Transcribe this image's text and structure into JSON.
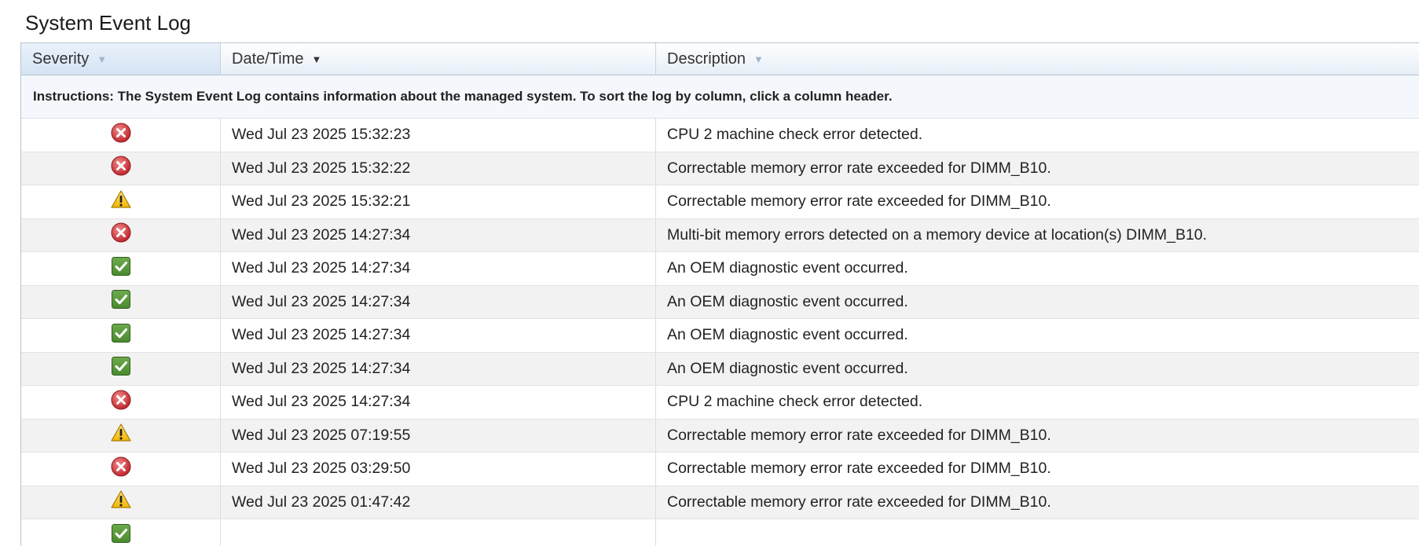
{
  "page": {
    "title": "System Event Log"
  },
  "table": {
    "columns": {
      "severity": "Severity",
      "datetime": "Date/Time",
      "description": "Description"
    },
    "sorted_column": "datetime",
    "instructions": "Instructions: The System Event Log contains information about the managed system. To sort the log by column, click a column header.",
    "rows": [
      {
        "severity": "error-icon",
        "datetime": "Wed Jul 23 2025 15:32:23",
        "description": "CPU 2 machine check error detected."
      },
      {
        "severity": "error-icon",
        "datetime": "Wed Jul 23 2025 15:32:22",
        "description": "Correctable memory error rate exceeded for DIMM_B10."
      },
      {
        "severity": "warning-icon",
        "datetime": "Wed Jul 23 2025 15:32:21",
        "description": "Correctable memory error rate exceeded for DIMM_B10."
      },
      {
        "severity": "error-icon",
        "datetime": "Wed Jul 23 2025 14:27:34",
        "description": "Multi-bit memory errors detected on a memory device at location(s) DIMM_B10."
      },
      {
        "severity": "ok-icon",
        "datetime": "Wed Jul 23 2025 14:27:34",
        "description": "An OEM diagnostic event occurred."
      },
      {
        "severity": "ok-icon",
        "datetime": "Wed Jul 23 2025 14:27:34",
        "description": "An OEM diagnostic event occurred."
      },
      {
        "severity": "ok-icon",
        "datetime": "Wed Jul 23 2025 14:27:34",
        "description": "An OEM diagnostic event occurred."
      },
      {
        "severity": "ok-icon",
        "datetime": "Wed Jul 23 2025 14:27:34",
        "description": "An OEM diagnostic event occurred."
      },
      {
        "severity": "error-icon",
        "datetime": "Wed Jul 23 2025 14:27:34",
        "description": "CPU 2 machine check error detected."
      },
      {
        "severity": "warning-icon",
        "datetime": "Wed Jul 23 2025 07:19:55",
        "description": "Correctable memory error rate exceeded for DIMM_B10."
      },
      {
        "severity": "error-icon",
        "datetime": "Wed Jul 23 2025 03:29:50",
        "description": "Correctable memory error rate exceeded for DIMM_B10."
      },
      {
        "severity": "warning-icon",
        "datetime": "Wed Jul 23 2025 01:47:42",
        "description": "Correctable memory error rate exceeded for DIMM_B10."
      },
      {
        "severity": "ok-icon",
        "datetime": "",
        "description": ""
      }
    ]
  },
  "colors": {
    "error": "#c0272d",
    "warning": "#f2b705",
    "ok": "#4a8a2e"
  }
}
